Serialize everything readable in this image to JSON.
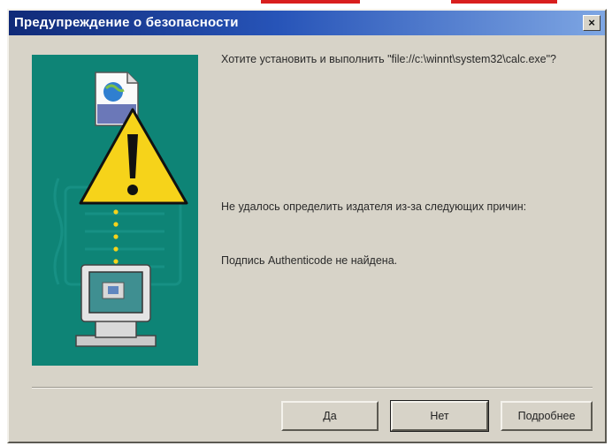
{
  "dialog": {
    "title": "Предупреждение о безопасности",
    "close_symbol": "×",
    "question": "Хотите установить и выполнить \"file://c:\\winnt\\system32\\calc.exe\"?",
    "publisher_reason": "Не удалось определить издателя из-за следующих причин:",
    "signature_reason": "Подпись Authenticode не найдена."
  },
  "buttons": {
    "yes": "Да",
    "no": "Нет",
    "details": "Подробнее"
  },
  "colors": {
    "title_gradient_start": "#102a78",
    "banner": "#0e8476",
    "warning_yellow": "#f6d31a"
  },
  "icons": {
    "document": "document-icon",
    "warning": "warning-icon",
    "computer": "computer-icon"
  }
}
